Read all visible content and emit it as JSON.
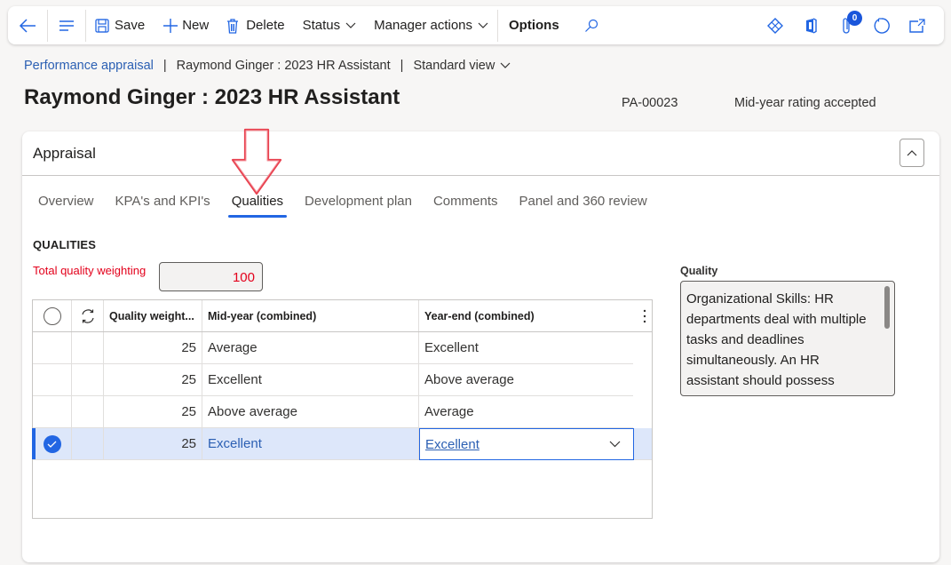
{
  "toolbar": {
    "back_label": "Back",
    "menu_label": "Menu",
    "save_label": "Save",
    "new_label": "New",
    "delete_label": "Delete",
    "status_label": "Status",
    "manager_actions_label": "Manager actions",
    "options_label": "Options",
    "attachments_count": "0",
    "right_icons": [
      "power-apps-icon",
      "office-icon",
      "attachment-icon",
      "refresh-icon",
      "open-new-window-icon"
    ]
  },
  "breadcrumb": {
    "module": "Performance appraisal",
    "record": "Raymond Ginger : 2023 HR Assistant",
    "view": "Standard view"
  },
  "header": {
    "title": "Raymond Ginger : 2023 HR Assistant",
    "record_id": "PA-00023",
    "status": "Mid-year rating accepted"
  },
  "card": {
    "title": "Appraisal",
    "tabs": [
      {
        "label": "Overview",
        "active": false
      },
      {
        "label": "KPA's and KPI's",
        "active": false
      },
      {
        "label": "Qualities",
        "active": true
      },
      {
        "label": "Development plan",
        "active": false
      },
      {
        "label": "Comments",
        "active": false
      },
      {
        "label": "Panel and 360 review",
        "active": false
      }
    ],
    "annotation": "red-arrow-pointing-to-qualities-tab"
  },
  "qualities": {
    "section_title": "QUALITIES",
    "total_weighting_label": "Total quality weighting",
    "total_weighting_value": "100",
    "columns": [
      "Quality weight...",
      "Mid-year (combined)",
      "Year-end (combined)"
    ],
    "rows": [
      {
        "weight": "25",
        "mid_year": "Average",
        "year_end": "Excellent",
        "selected": false
      },
      {
        "weight": "25",
        "mid_year": "Excellent",
        "year_end": "Above average",
        "selected": false
      },
      {
        "weight": "25",
        "mid_year": "Above average",
        "year_end": "Average",
        "selected": false
      },
      {
        "weight": "25",
        "mid_year": "Excellent",
        "year_end": "Excellent",
        "selected": true
      }
    ]
  },
  "quality_panel": {
    "label": "Quality",
    "text": "Organizational Skills: HR departments deal with multiple tasks and deadlines simultaneously. An HR assistant should possess"
  },
  "colors": {
    "accent": "#2266e3",
    "link": "#2b5fb3",
    "required_red": "#e3001b",
    "selected_row": "#dde7fa"
  }
}
